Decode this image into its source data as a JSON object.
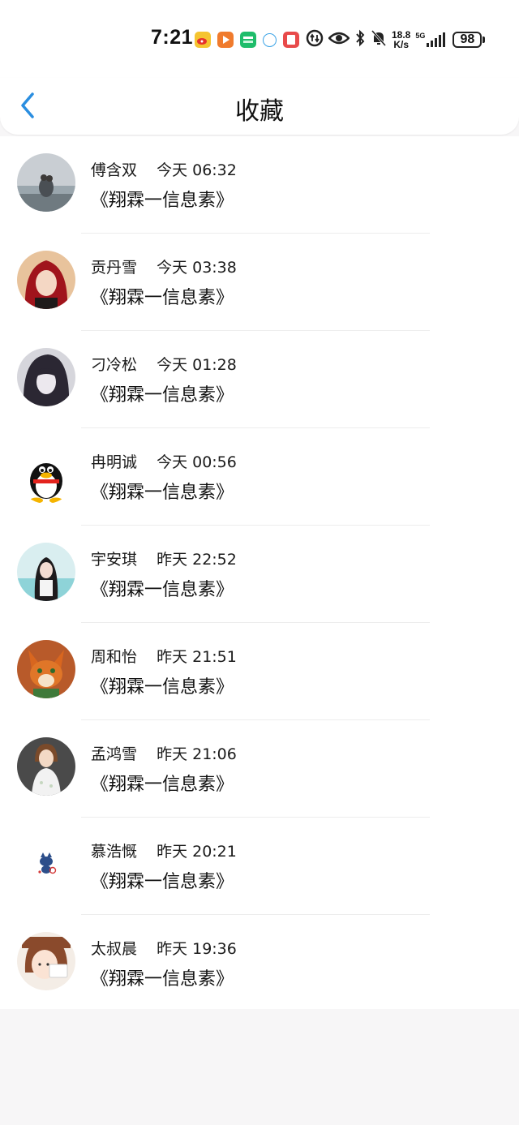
{
  "status_bar": {
    "time": "7:21",
    "net_speed_value": "18.8",
    "net_speed_unit": "K/s",
    "signal_label": "5G",
    "battery": "98",
    "app_icons": [
      "weibo-icon",
      "video-app-icon",
      "iqiyi-icon",
      "bilibili-icon",
      "reader-icon"
    ],
    "colors": {
      "weibo": "#f5c430",
      "video": "#f07b2d",
      "iqiyi": "#1fbd6b",
      "bili": "#3ba3e6",
      "reader": "#e84a4a"
    }
  },
  "header": {
    "title": "收藏",
    "back_color": "#2a8ee0"
  },
  "favorites": [
    {
      "name": "傅含双",
      "time": "今天 06:32",
      "message": "《翔霖一信息素》",
      "avatar": "beach-couple"
    },
    {
      "name": "贡丹雪",
      "time": "今天 03:38",
      "message": "《翔霖一信息素》",
      "avatar": "red-hair-girl"
    },
    {
      "name": "刁冷松",
      "time": "今天 01:28",
      "message": "《翔霖一信息素》",
      "avatar": "anime-dark-hair"
    },
    {
      "name": "冉明诚",
      "time": "今天 00:56",
      "message": "《翔霖一信息素》",
      "avatar": "qq-penguin"
    },
    {
      "name": "宇安琪",
      "time": "昨天 22:52",
      "message": "《翔霖一信息素》",
      "avatar": "girl-water"
    },
    {
      "name": "周和怡",
      "time": "昨天 21:51",
      "message": "《翔霖一信息素》",
      "avatar": "cartoon-fox"
    },
    {
      "name": "孟鸿雪",
      "time": "昨天 21:06",
      "message": "《翔霖一信息素》",
      "avatar": "girl-white-dress"
    },
    {
      "name": "慕浩慨",
      "time": "昨天 20:21",
      "message": "《翔霖一信息素》",
      "avatar": "small-cartoon"
    },
    {
      "name": "太叔晨",
      "time": "昨天 19:36",
      "message": "《翔霖一信息素》",
      "avatar": "cartoon-girl-sign"
    }
  ]
}
